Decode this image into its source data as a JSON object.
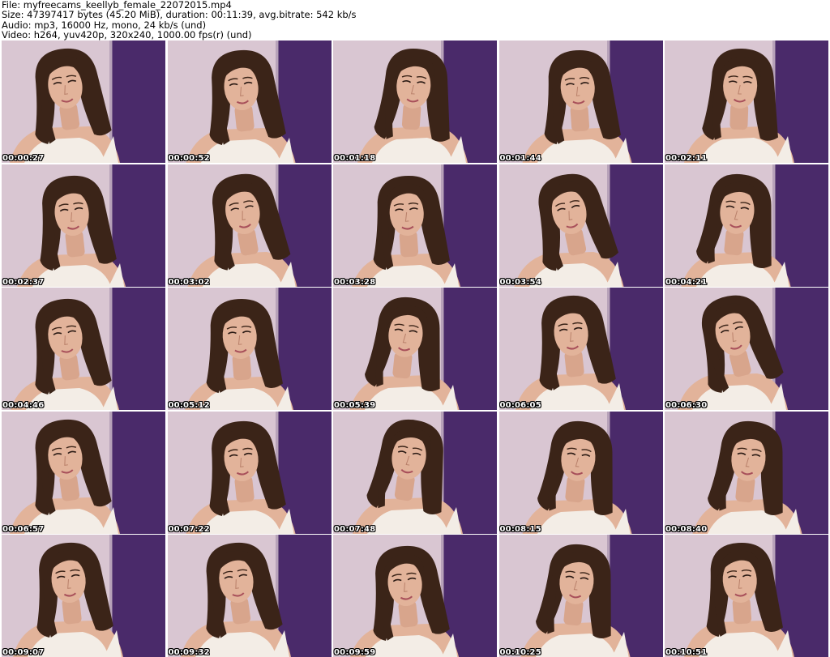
{
  "header": {
    "file_line": "File: myfreecams_keellyb_female_22072015.mp4",
    "size_line": "Size: 47397417 bytes (45.20 MiB), duration: 00:11:39, avg.bitrate: 542 kb/s",
    "audio_line": "Audio: mp3, 16000 Hz, mono, 24 kb/s (und)",
    "video_line": "Video: h264, yuv420p, 320x240, 1000.00 fps(r) (und)"
  },
  "thumbnails": [
    {
      "timestamp": "00:00:27"
    },
    {
      "timestamp": "00:00:52"
    },
    {
      "timestamp": "00:01:18"
    },
    {
      "timestamp": "00:01:44"
    },
    {
      "timestamp": "00:02:11"
    },
    {
      "timestamp": "00:02:37"
    },
    {
      "timestamp": "00:03:02"
    },
    {
      "timestamp": "00:03:28"
    },
    {
      "timestamp": "00:03:54"
    },
    {
      "timestamp": "00:04:21"
    },
    {
      "timestamp": "00:04:46"
    },
    {
      "timestamp": "00:05:12"
    },
    {
      "timestamp": "00:05:39"
    },
    {
      "timestamp": "00:06:05"
    },
    {
      "timestamp": "00:06:30"
    },
    {
      "timestamp": "00:06:57"
    },
    {
      "timestamp": "00:07:22"
    },
    {
      "timestamp": "00:07:48"
    },
    {
      "timestamp": "00:08:15"
    },
    {
      "timestamp": "00:08:40"
    },
    {
      "timestamp": "00:09:07"
    },
    {
      "timestamp": "00:09:32"
    },
    {
      "timestamp": "00:09:59"
    },
    {
      "timestamp": "00:10:25"
    },
    {
      "timestamp": "00:10:51"
    }
  ],
  "colors": {
    "wall": "#d9c6d2",
    "purple_panel": "#4a2a6a",
    "hair": "#3b2418",
    "skin": "#e2b39a",
    "top": "#f3ede6"
  }
}
